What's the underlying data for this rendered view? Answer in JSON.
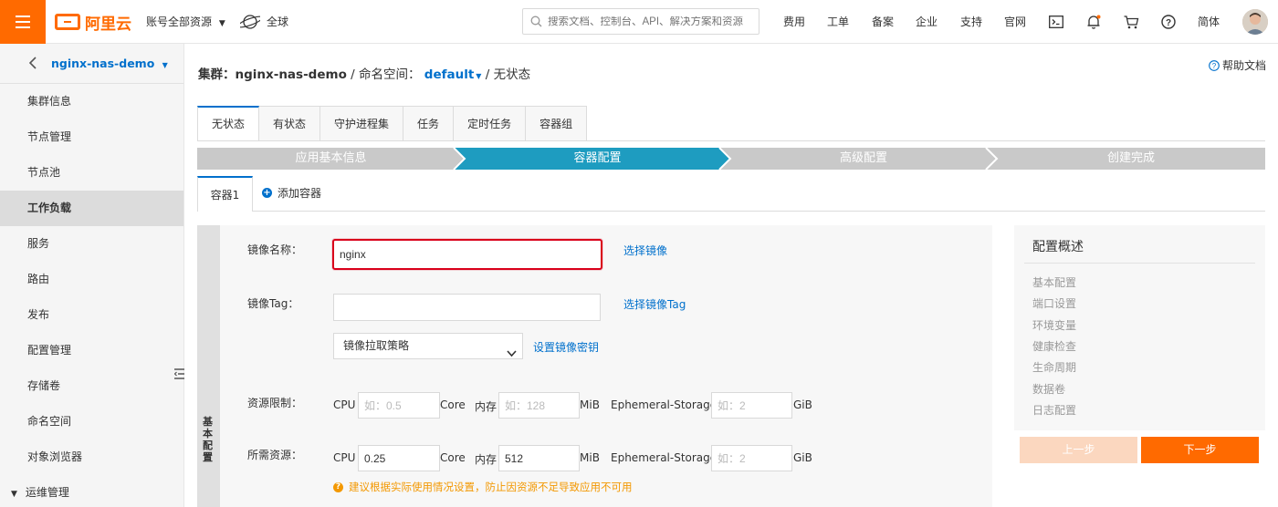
{
  "topbar": {
    "logo_text": "阿里云",
    "account_scope": "账号全部资源",
    "region": "全球",
    "search_placeholder": "搜索文档、控制台、API、解决方案和资源",
    "nav": [
      "费用",
      "工单",
      "备案",
      "企业",
      "支持",
      "官网"
    ],
    "language": "简体",
    "accent_color": "#ff6a00"
  },
  "sidebar": {
    "cluster_name": "nginx-nas-demo",
    "items": [
      {
        "label": "集群信息",
        "active": false
      },
      {
        "label": "节点管理",
        "active": false
      },
      {
        "label": "节点池",
        "active": false
      },
      {
        "label": "工作负载",
        "active": true
      },
      {
        "label": "服务",
        "active": false
      },
      {
        "label": "路由",
        "active": false
      },
      {
        "label": "发布",
        "active": false
      },
      {
        "label": "配置管理",
        "active": false
      },
      {
        "label": "存储卷",
        "active": false
      },
      {
        "label": "命名空间",
        "active": false
      },
      {
        "label": "对象浏览器",
        "active": false
      }
    ],
    "group_label": "运维管理"
  },
  "breadcrumb": {
    "cluster_prefix": "集群：",
    "cluster": "nginx-nas-demo",
    "sep1": " / ",
    "ns_prefix": "命名空间：",
    "namespace": "default",
    "sep2": " / ",
    "page": "无状态"
  },
  "help_label": "帮助文档",
  "tabs": [
    "无状态",
    "有状态",
    "守护进程集",
    "任务",
    "定时任务",
    "容器组"
  ],
  "steps": [
    {
      "label": "应用基本信息",
      "active": false
    },
    {
      "label": "容器配置",
      "active": true
    },
    {
      "label": "高级配置",
      "active": false
    },
    {
      "label": "创建完成",
      "active": false
    }
  ],
  "container_tab": "容器1",
  "add_container_label": "添加容器",
  "section_label": "基本配置",
  "form": {
    "image_name_label": "镜像名称：",
    "image_name_value": "nginx",
    "select_image_link": "选择镜像",
    "image_tag_label": "镜像Tag：",
    "image_tag_value": "",
    "select_tag_link": "选择镜像Tag",
    "pull_policy": "镜像拉取策略",
    "set_secret_link": "设置镜像密钥",
    "limit_label": "资源限制：",
    "request_label": "所需资源：",
    "cpu_label": "CPU",
    "core_unit": "Core",
    "mem_label": "内存",
    "mib_unit": "MiB",
    "eph_label": "Ephemeral-Storage",
    "gib_unit": "GiB",
    "limit_cpu_placeholder": "如：0.5",
    "limit_mem_placeholder": "如：128",
    "limit_eph_placeholder": "如：2",
    "request_cpu_value": "0.25",
    "request_mem_value": "512",
    "request_eph_placeholder": "如：2",
    "warning": "建议根据实际使用情况设置，防止因资源不足导致应用不可用"
  },
  "summary": {
    "title": "配置概述",
    "items": [
      "基本配置",
      "端口设置",
      "环境变量",
      "健康检查",
      "生命周期",
      "数据卷",
      "日志配置"
    ]
  },
  "buttons": {
    "prev": "上一步",
    "next": "下一步"
  }
}
